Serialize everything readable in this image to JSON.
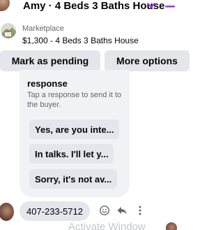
{
  "header": {
    "title": "Amy · 4 Beds 3 Baths House",
    "chevron_icon": "chevron-down-icon",
    "minimize_icon": "minimize-icon",
    "accent": "#a033ff"
  },
  "marketplace": {
    "label": "Marketplace",
    "listing": "$1,300 - 4 Beds 3 Baths House"
  },
  "actions": {
    "pending_label": "Mark as pending",
    "more_label": "More options"
  },
  "responses": {
    "title": "response",
    "subtitle": "Tap a response to send it to the buyer.",
    "items": [
      {
        "label": "Yes, are you inte..."
      },
      {
        "label": "In talks. I'll let y..."
      },
      {
        "label": "Sorry, it's not av..."
      }
    ]
  },
  "message": {
    "phone": "407-233-5712",
    "icons": [
      "smile-icon",
      "reply-icon",
      "more-icon"
    ]
  },
  "watermark": "Activate Window"
}
